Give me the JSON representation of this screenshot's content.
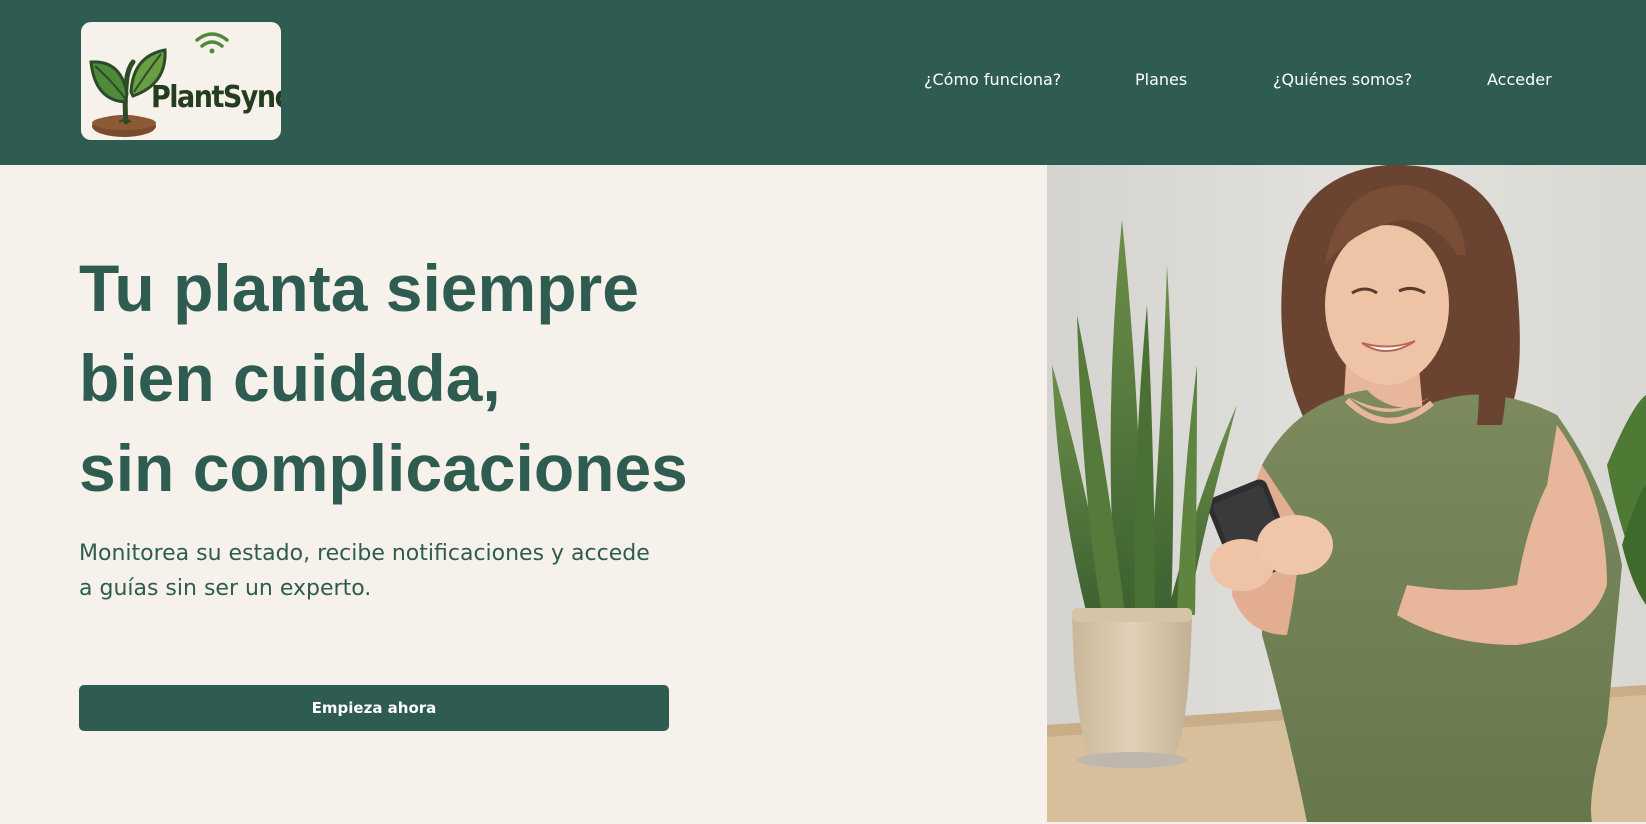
{
  "brand": {
    "name": "PlantSync",
    "logo_icon": "sprout-wifi-icon",
    "colors": {
      "primary": "#2f5c50",
      "background": "#f6f2eb",
      "leaf": "#4f8a3a"
    }
  },
  "nav": {
    "items": [
      {
        "label": "¿Cómo funciona?"
      },
      {
        "label": "Planes"
      },
      {
        "label": "¿Quiénes somos?"
      },
      {
        "label": "Acceder"
      }
    ]
  },
  "hero": {
    "headline_lines": [
      "Tu planta siempre",
      "bien cuidada,",
      "sin complicaciones"
    ],
    "subtitle": "Monitorea su estado, recibe notificaciones y accede a guías sin ser un experto.",
    "cta_label": "Empieza ahora",
    "image": "woman-with-phone-and-snake-plant-photo"
  }
}
